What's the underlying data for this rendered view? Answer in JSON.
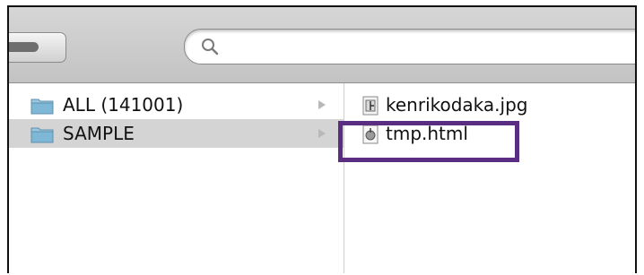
{
  "search": {
    "placeholder": "",
    "value": ""
  },
  "column_one": {
    "items": [
      {
        "label": "ALL (141001)",
        "icon": "folder-icon",
        "selected": false
      },
      {
        "label": "SAMPLE",
        "icon": "folder-icon",
        "selected": true
      }
    ]
  },
  "column_two": {
    "items": [
      {
        "label": "kenrikodaka.jpg",
        "icon": "image-file-icon"
      },
      {
        "label": "tmp.html",
        "icon": "html-file-icon"
      }
    ]
  },
  "colors": {
    "highlight": "#5a2d82",
    "selection": "#d4d4d4",
    "folder": "#7fb7d6"
  }
}
